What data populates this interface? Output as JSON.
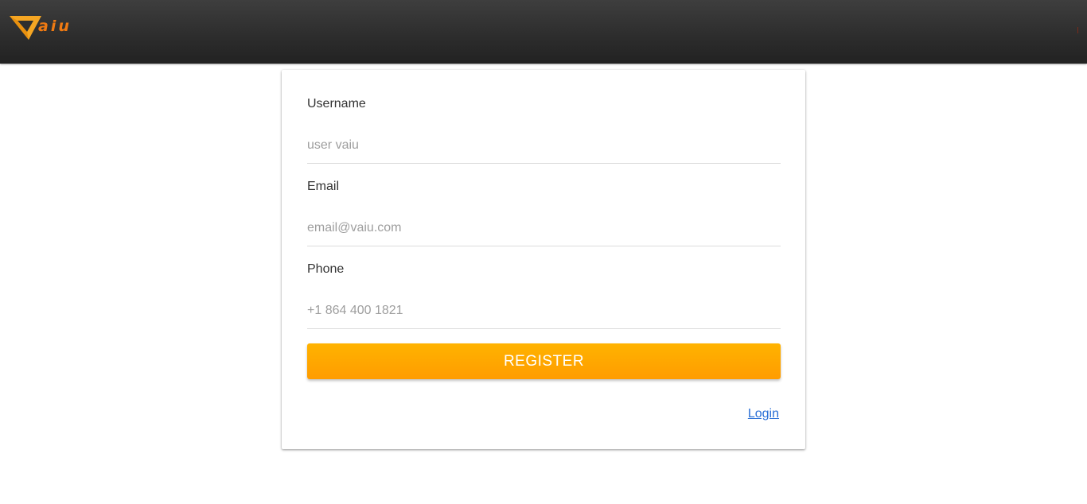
{
  "header": {
    "logo_text": "aiu",
    "brand_colors": {
      "logo_yellow": "#f5a623",
      "logo_orange": "#f07a12",
      "bar": "#2c2c2c"
    },
    "logo_icon": "v-chevron-logo-icon"
  },
  "form": {
    "username": {
      "label": "Username",
      "placeholder": "user vaiu"
    },
    "email": {
      "label": "Email",
      "placeholder": "email@vaiu.com"
    },
    "phone": {
      "label": "Phone",
      "placeholder": "+1 864 400 1821"
    },
    "register_label": "REGISTER",
    "login_label": "Login",
    "accent": "#ffa800",
    "link_color": "#2a6fd6"
  }
}
